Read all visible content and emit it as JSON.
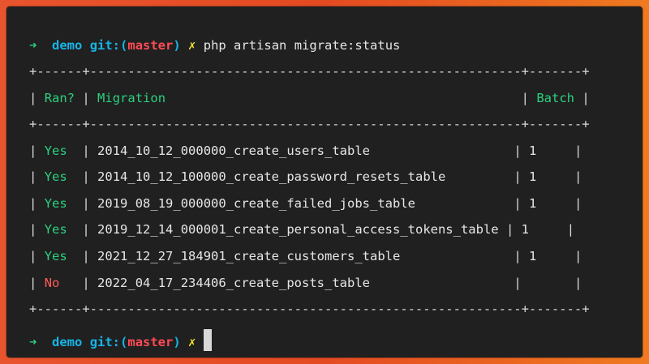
{
  "prompt": {
    "arrow": "➜",
    "dir": "demo",
    "git_label": "git:(",
    "branch": "master",
    "git_close": ")",
    "dirty": "✗"
  },
  "command": "php artisan migrate:status",
  "table": {
    "separator": "+------+---------------------------------------------------------+-------+",
    "headers": [
      "Ran?",
      "Migration",
      "Batch"
    ],
    "rows": [
      {
        "ran": "Yes",
        "migration": "2014_10_12_000000_create_users_table",
        "batch": "1"
      },
      {
        "ran": "Yes",
        "migration": "2014_10_12_100000_create_password_resets_table",
        "batch": "1"
      },
      {
        "ran": "Yes",
        "migration": "2019_08_19_000000_create_failed_jobs_table",
        "batch": "1"
      },
      {
        "ran": "Yes",
        "migration": "2019_12_14_000001_create_personal_access_tokens_table",
        "batch": "1"
      },
      {
        "ran": "Yes",
        "migration": "2021_12_27_184901_create_customers_table",
        "batch": "1"
      },
      {
        "ran": "No",
        "migration": "2022_04_17_234406_create_posts_table",
        "batch": ""
      }
    ]
  },
  "colors": {
    "background": "#202020",
    "green": "#2bd17f",
    "cyan": "#18b4e6",
    "red": "#ff4b55",
    "yellow": "#f5e52a"
  }
}
